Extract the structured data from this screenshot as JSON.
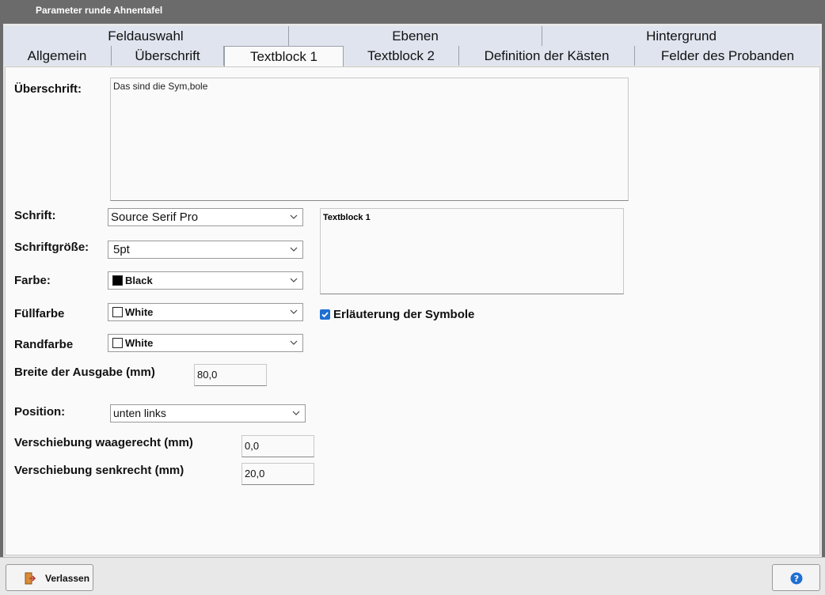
{
  "window": {
    "title": "Parameter runde Ahnentafel"
  },
  "tabs_row1": [
    "Feldauswahl",
    "Ebenen",
    "Hintergrund"
  ],
  "tabs_row2": [
    "Allgemein",
    "Überschrift",
    "Textblock 1",
    "Textblock 2",
    "Definition der Kästen",
    "Felder des Probanden"
  ],
  "active_tab": "Textblock 1",
  "form": {
    "ueberschrift_label": "Überschrift:",
    "ueberschrift_value": "Das sind die Sym,bole",
    "schrift_label": "Schrift:",
    "schrift_value": "Source Serif Pro",
    "groesse_label": "Schriftgröße:",
    "groesse_value": "5pt",
    "farbe_label": "Farbe:",
    "farbe_value": "Black",
    "farbe_color": "#000000",
    "fuell_label": "Füllfarbe",
    "fuell_value": "White",
    "fuell_color": "#ffffff",
    "rand_label": "Randfarbe",
    "rand_value": "White",
    "rand_color": "#ffffff",
    "breite_label": "Breite der Ausgabe (mm)",
    "breite_value": "80,0",
    "position_label": "Position:",
    "position_value": "unten links",
    "waag_label": "Verschiebung waagerecht (mm)",
    "waag_value": "0,0",
    "senk_label": "Verschiebung senkrecht (mm)",
    "senk_value": "20,0",
    "preview_text": "Textblock 1",
    "symbole_label": "Erläuterung der Symbole",
    "symbole_checked": true
  },
  "buttons": {
    "exit": "Verlassen"
  },
  "icons": {
    "exit": "exit-door-icon",
    "help": "help-icon",
    "chevron": "chevron-down-icon",
    "check": "check-icon"
  },
  "colors": {
    "accent": "#1e6fd1",
    "tab_inactive": "#dfe4ee"
  }
}
